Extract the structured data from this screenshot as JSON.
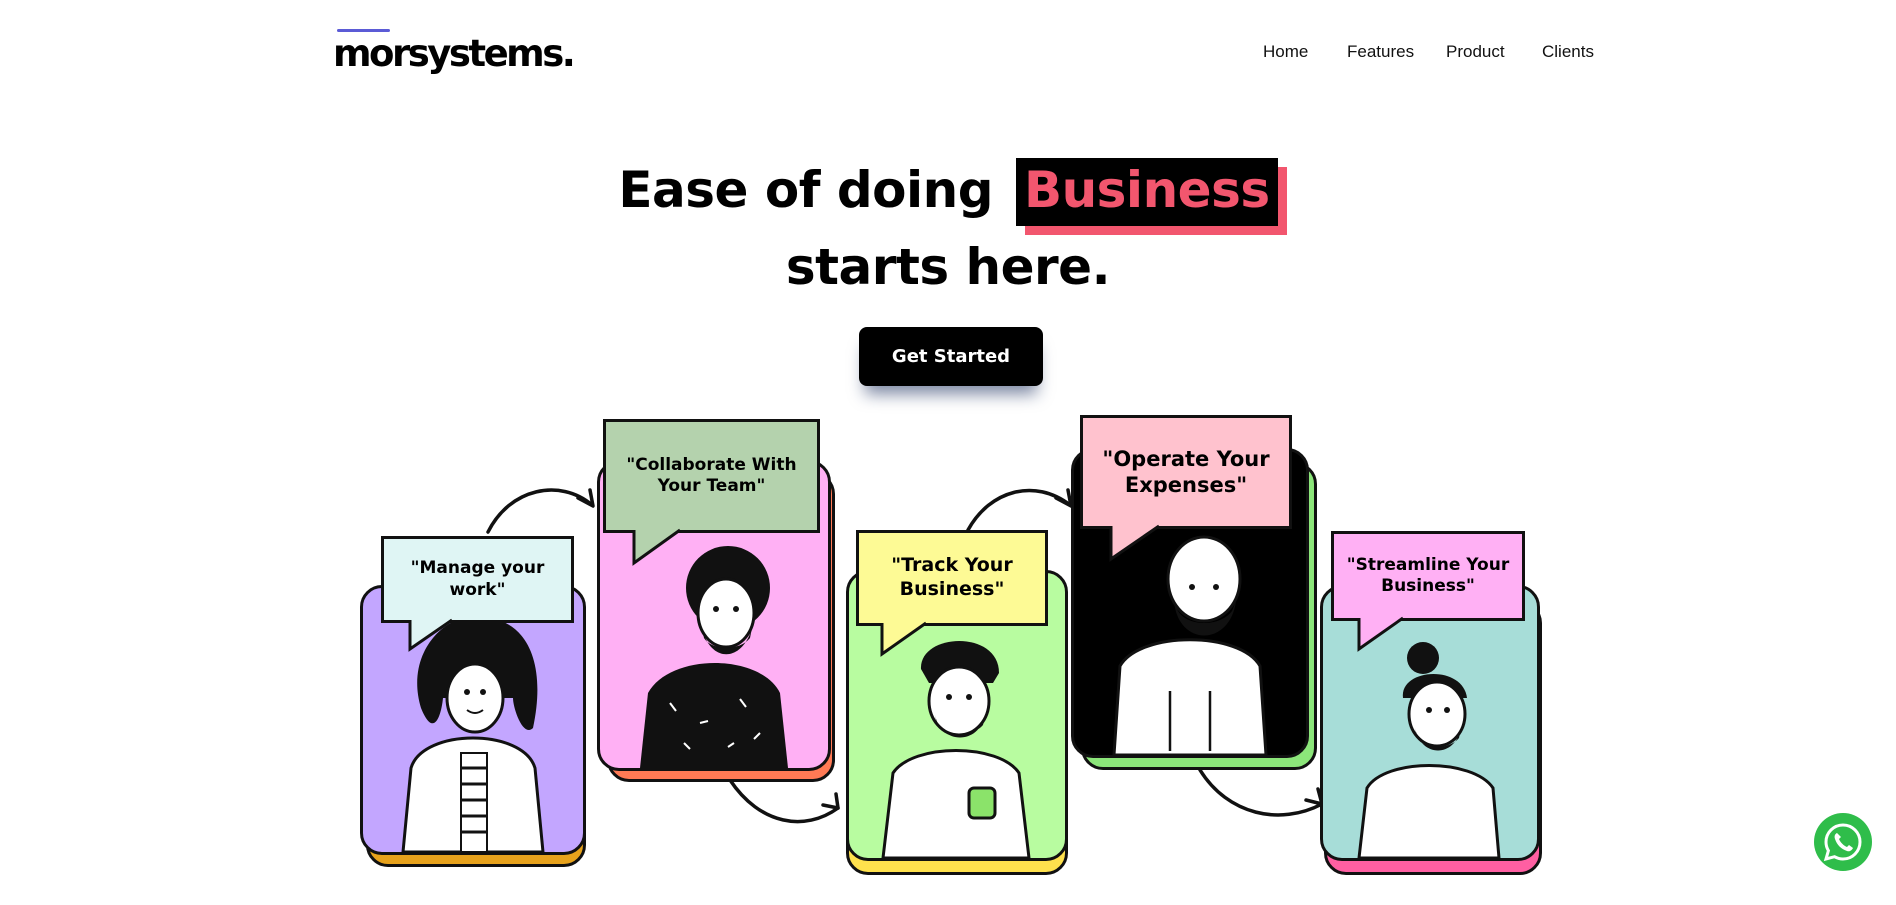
{
  "header": {
    "logo_text": "morsystems.",
    "nav": [
      "Home",
      "Features",
      "Product",
      "Clients"
    ]
  },
  "hero": {
    "line1_prefix": "Ease of doing",
    "highlight": "Business",
    "line2": "starts here.",
    "cta_label": "Get Started"
  },
  "cards": [
    {
      "quote": "\"Manage your work\"",
      "bg": "#c3a6ff",
      "back": "#e7a21c",
      "bubble": "#dff5f4"
    },
    {
      "quote": "\"Collaborate With Your Team\"",
      "bg": "#ffb0f4",
      "back": "#ff7a55",
      "bubble": "#b4d2ad"
    },
    {
      "quote": "\"Track Your Business\"",
      "bg": "#b8fca0",
      "back": "#ffe14d",
      "bubble": "#fdfa95"
    },
    {
      "quote": "\"Operate Your Expenses\"",
      "bg": "#000000",
      "back": "#8ce67a",
      "bubble": "#ffc2ce"
    },
    {
      "quote": "\"Streamline Your Business\"",
      "bg": "#a7ddd8",
      "back": "#ff5fa2",
      "bubble": "#ffb0f4"
    }
  ],
  "colors": {
    "accent": "#f2566e",
    "logo_bar": "#5b5bd6",
    "whatsapp": "#2fbd4a"
  },
  "icons": {
    "floating": "whatsapp-icon"
  }
}
